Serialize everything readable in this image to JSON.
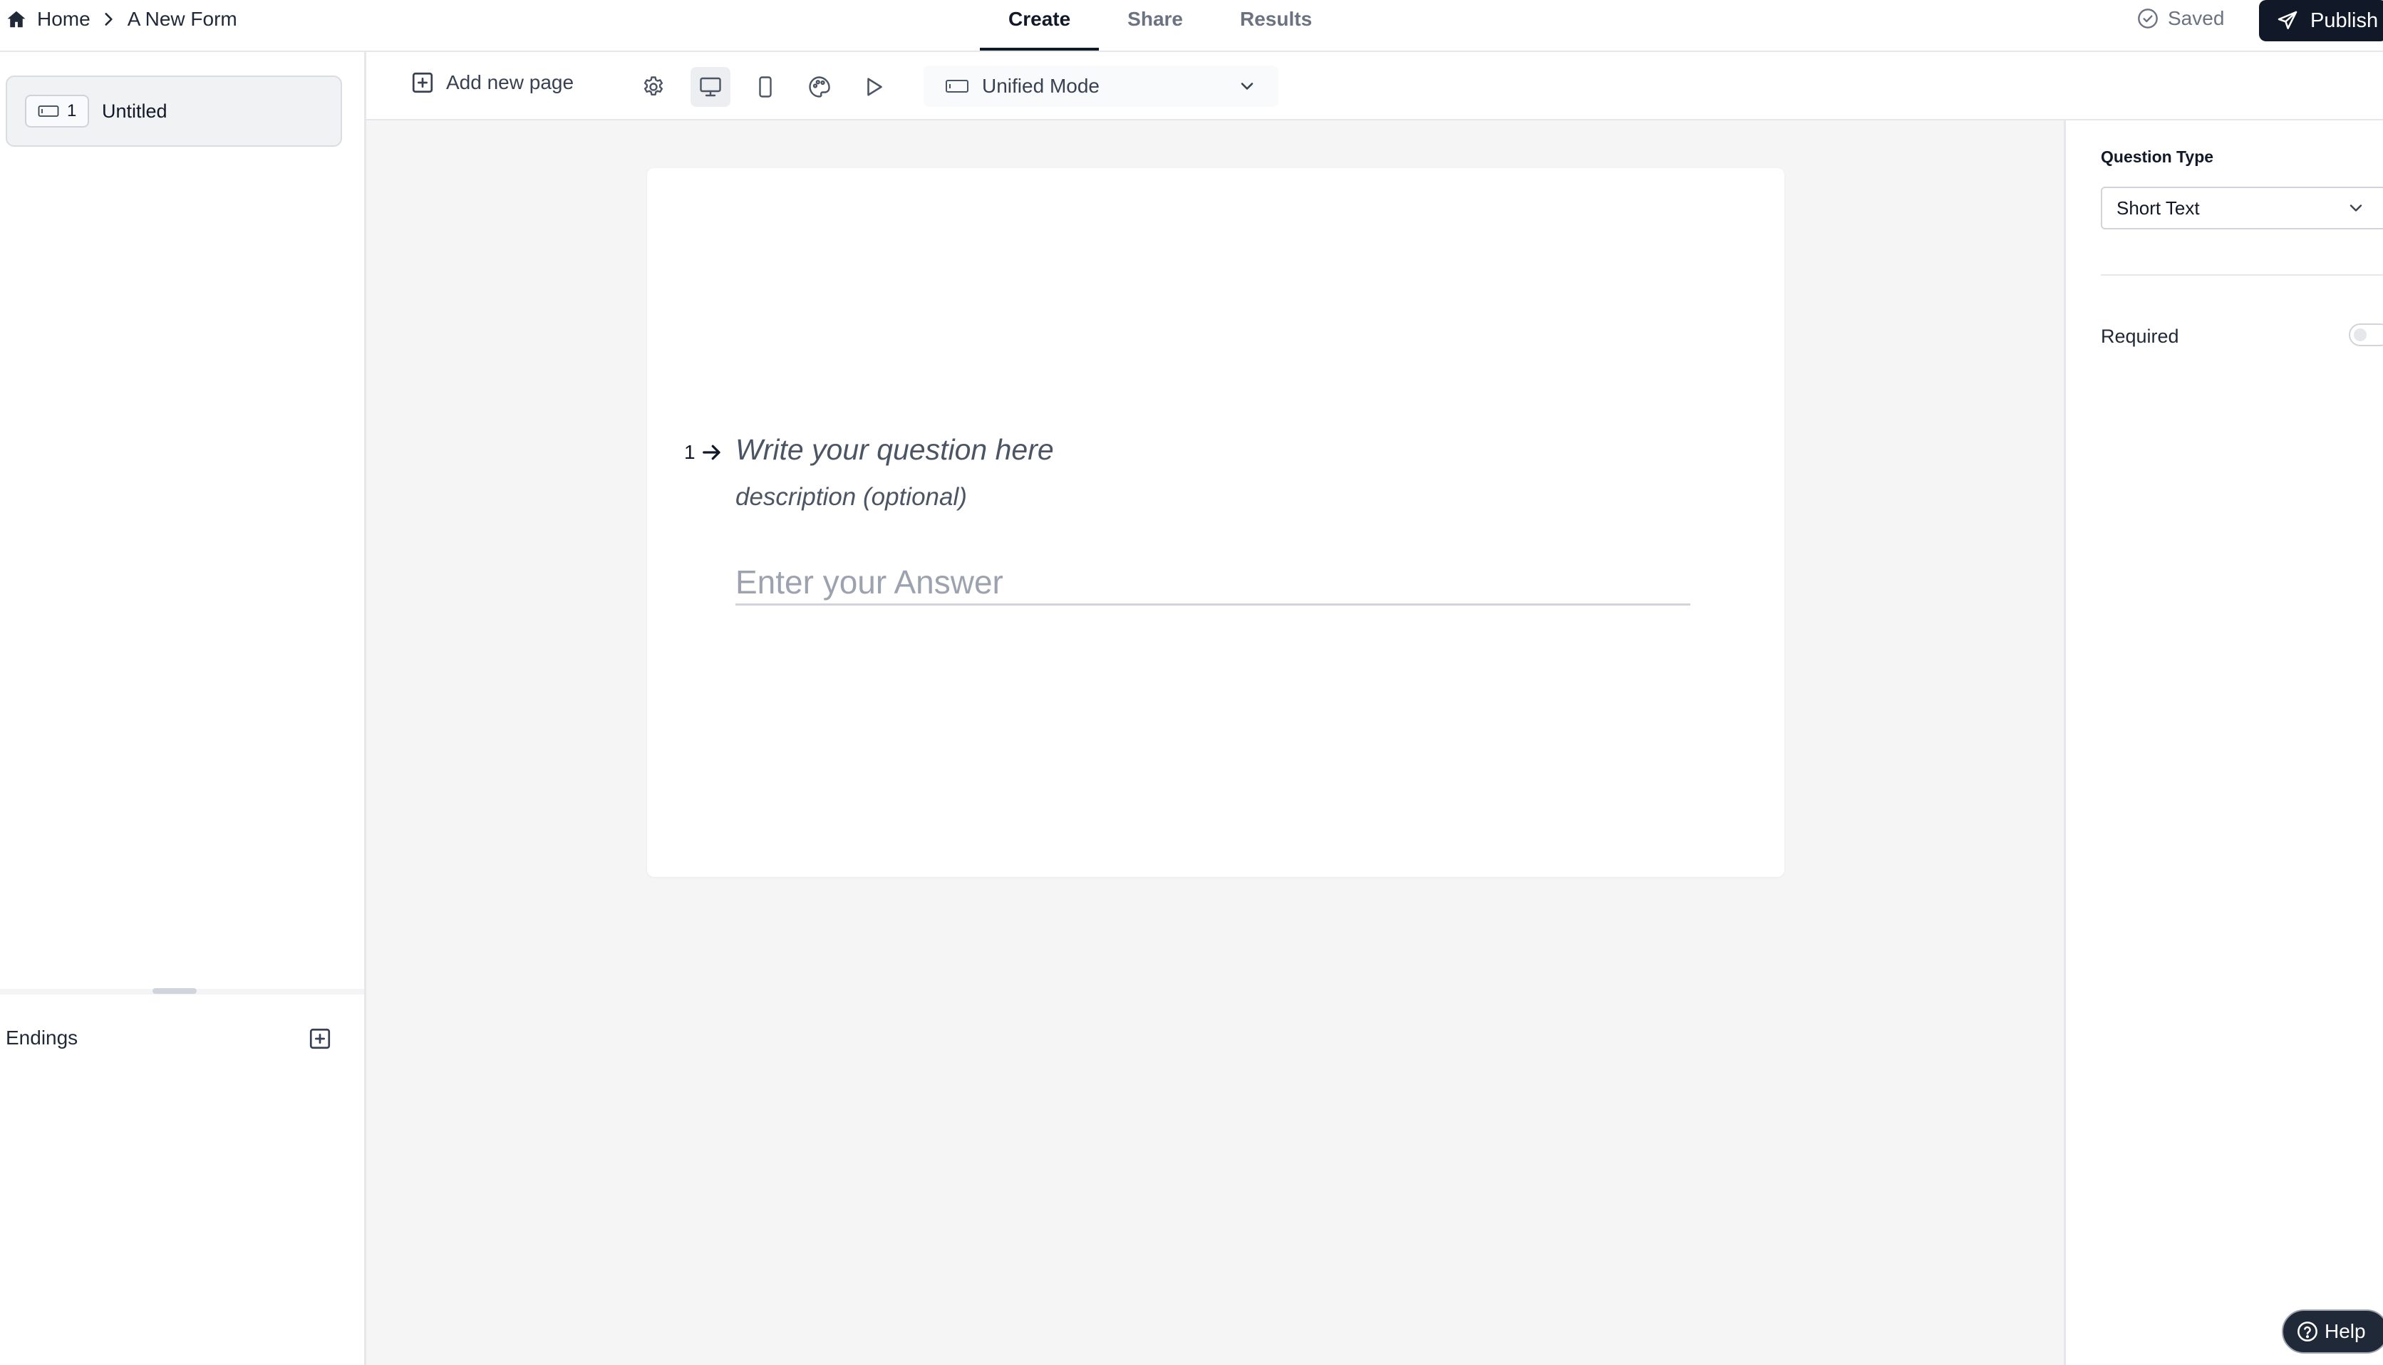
{
  "header": {
    "breadcrumb": {
      "home_label": "Home",
      "form_name": "A New Form"
    },
    "tabs": [
      {
        "label": "Create",
        "active": true
      },
      {
        "label": "Share",
        "active": false
      },
      {
        "label": "Results",
        "active": false
      }
    ],
    "save_status": "Saved",
    "publish_label": "Publish"
  },
  "sidebar": {
    "pages": [
      {
        "number": "1",
        "name": "Untitled"
      }
    ],
    "endings_label": "Endings"
  },
  "toolbar": {
    "add_page_label": "Add new page",
    "mode_select_value": "Unified Mode",
    "active_view": "desktop"
  },
  "form": {
    "question_number": "1",
    "question_placeholder": "Write your question here",
    "description_placeholder": "description (optional)",
    "answer_placeholder": "Enter your Answer"
  },
  "properties": {
    "question_type_label": "Question Type",
    "question_type_value": "Short Text",
    "required_label": "Required",
    "required_on": false
  },
  "help_label": "Help",
  "colors": {
    "primary_dark": "#111827",
    "canvas_bg": "#f5f5f5",
    "border": "#e5e7eb",
    "muted_text": "#6b7280"
  }
}
